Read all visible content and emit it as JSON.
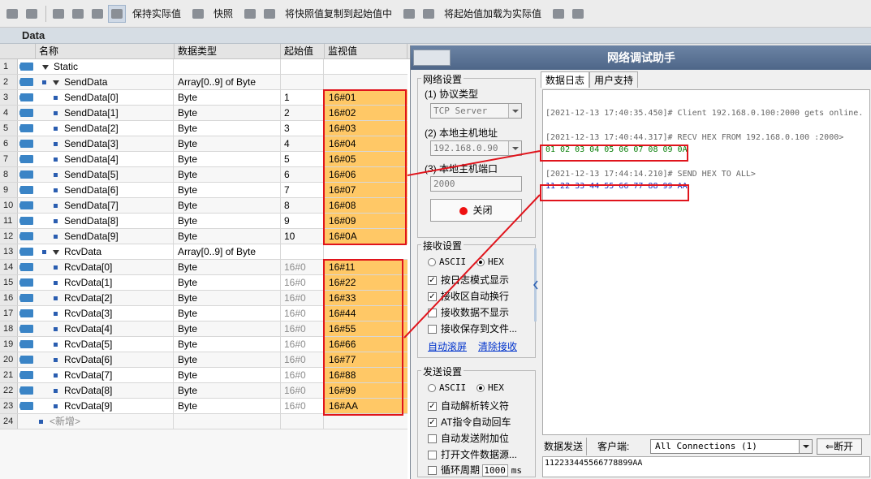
{
  "toolbar": {
    "keep_actual": "保持实际值",
    "snapshot": "快照",
    "copy_snapshot": "将快照值复制到起始值中",
    "load_start": "将起始值加载为实际值"
  },
  "editor_title": "Data",
  "columns": {
    "name": "名称",
    "type": "数据类型",
    "start": "起始值",
    "monitor": "监视值"
  },
  "rows": [
    {
      "num": "1",
      "name": "Static",
      "type": "",
      "start": "",
      "monitor": ""
    },
    {
      "num": "2",
      "name": "SendData",
      "type": "Array[0..9] of Byte",
      "start": "",
      "monitor": ""
    },
    {
      "num": "3",
      "name": "SendData[0]",
      "type": "Byte",
      "start": "1",
      "monitor": "16#01"
    },
    {
      "num": "4",
      "name": "SendData[1]",
      "type": "Byte",
      "start": "2",
      "monitor": "16#02"
    },
    {
      "num": "5",
      "name": "SendData[2]",
      "type": "Byte",
      "start": "3",
      "monitor": "16#03"
    },
    {
      "num": "6",
      "name": "SendData[3]",
      "type": "Byte",
      "start": "4",
      "monitor": "16#04"
    },
    {
      "num": "7",
      "name": "SendData[4]",
      "type": "Byte",
      "start": "5",
      "monitor": "16#05"
    },
    {
      "num": "8",
      "name": "SendData[5]",
      "type": "Byte",
      "start": "6",
      "monitor": "16#06"
    },
    {
      "num": "9",
      "name": "SendData[6]",
      "type": "Byte",
      "start": "7",
      "monitor": "16#07"
    },
    {
      "num": "10",
      "name": "SendData[7]",
      "type": "Byte",
      "start": "8",
      "monitor": "16#08"
    },
    {
      "num": "11",
      "name": "SendData[8]",
      "type": "Byte",
      "start": "9",
      "monitor": "16#09"
    },
    {
      "num": "12",
      "name": "SendData[9]",
      "type": "Byte",
      "start": "10",
      "monitor": "16#0A"
    },
    {
      "num": "13",
      "name": "RcvData",
      "type": "Array[0..9] of Byte",
      "start": "",
      "monitor": ""
    },
    {
      "num": "14",
      "name": "RcvData[0]",
      "type": "Byte",
      "start": "16#0",
      "monitor": "16#11"
    },
    {
      "num": "15",
      "name": "RcvData[1]",
      "type": "Byte",
      "start": "16#0",
      "monitor": "16#22"
    },
    {
      "num": "16",
      "name": "RcvData[2]",
      "type": "Byte",
      "start": "16#0",
      "monitor": "16#33"
    },
    {
      "num": "17",
      "name": "RcvData[3]",
      "type": "Byte",
      "start": "16#0",
      "monitor": "16#44"
    },
    {
      "num": "18",
      "name": "RcvData[4]",
      "type": "Byte",
      "start": "16#0",
      "monitor": "16#55"
    },
    {
      "num": "19",
      "name": "RcvData[5]",
      "type": "Byte",
      "start": "16#0",
      "monitor": "16#66"
    },
    {
      "num": "20",
      "name": "RcvData[6]",
      "type": "Byte",
      "start": "16#0",
      "monitor": "16#77"
    },
    {
      "num": "21",
      "name": "RcvData[7]",
      "type": "Byte",
      "start": "16#0",
      "monitor": "16#88"
    },
    {
      "num": "22",
      "name": "RcvData[8]",
      "type": "Byte",
      "start": "16#0",
      "monitor": "16#99"
    },
    {
      "num": "23",
      "name": "RcvData[9]",
      "type": "Byte",
      "start": "16#0",
      "monitor": "16#AA"
    },
    {
      "num": "24",
      "name": "<新增>",
      "type": "",
      "start": "",
      "monitor": ""
    }
  ],
  "net": {
    "title": "网络调试助手",
    "net_settings": "网络设置",
    "protocol_label": "(1) 协议类型",
    "protocol_value": "TCP Server",
    "host_label": "(2) 本地主机地址",
    "host_value": "192.168.0.90",
    "port_label": "(3) 本地主机端口",
    "port_value": "2000",
    "close_btn": "关闭",
    "recv_settings": "接收设置",
    "ascii": "ASCII",
    "hex": "HEX",
    "recv_opt1": "按日志模式显示",
    "recv_opt2": "接收区自动换行",
    "recv_opt3": "接收数据不显示",
    "recv_opt4": "接收保存到文件...",
    "auto_scroll": "自动滚屏",
    "clear_recv": "清除接收",
    "send_settings": "发送设置",
    "send_opt1": "自动解析转义符",
    "send_opt2": "AT指令自动回车",
    "send_opt3": "自动发送附加位",
    "send_opt4": "打开文件数据源...",
    "send_opt5": "循环周期",
    "cycle_value": "1000",
    "cycle_unit": "ms",
    "tab_log": "数据日志",
    "tab_user": "用户支持",
    "log1": "[2021-12-13 17:40:35.450]# Client 192.168.0.100:2000 gets online.",
    "log2": "[2021-12-13 17:40:44.317]# RECV HEX FROM 192.168.0.100 :2000>",
    "log3": "01 02 03 04 05 06 07 08 09 0A",
    "log4": "[2021-12-13 17:44:14.210]# SEND HEX TO ALL>",
    "log5": "11 22 33 44 55 66 77 88 99 AA",
    "send_tab": "数据发送",
    "client_label": "客户端:",
    "client_value": "All Connections (1)",
    "disconnect": "断开",
    "send_text": "112233445566778899AA"
  },
  "colors": {
    "monitor_bg": "#ffc866",
    "highlight": "#e0141c",
    "recv": "#0a7f0a",
    "send": "#1a2bbd"
  }
}
